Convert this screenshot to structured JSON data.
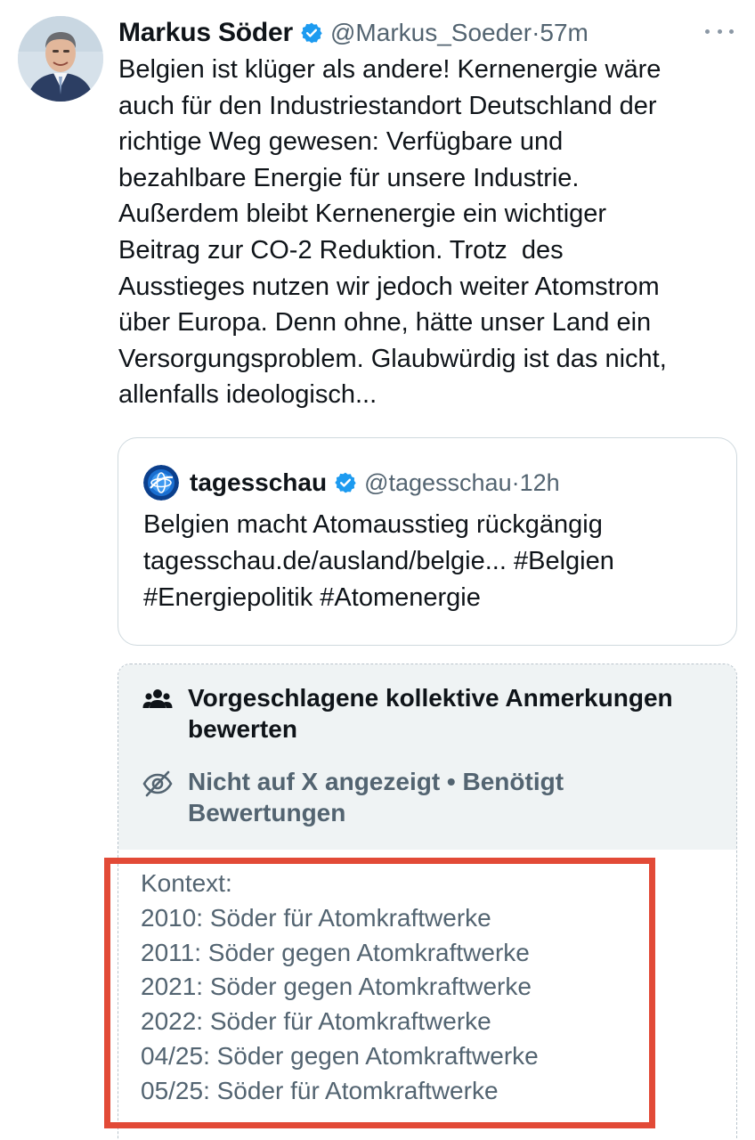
{
  "tweet": {
    "author_name": "Markus Söder",
    "handle": "@Markus_Soeder",
    "separator": " · ",
    "time": "57m",
    "lines": [
      "Belgien ist klüger als andere! Kernenergie wäre",
      "auch für den Industriestandort Deutschland der",
      "richtige Weg gewesen: Verfügbare und",
      "bezahlbare Energie für unsere Industrie.",
      "Außerdem bleibt Kernenergie ein wichtiger",
      "Beitrag zur CO-2 Reduktion. Trotz  des",
      "Ausstieges nutzen wir jedoch weiter Atomstrom",
      "über Europa. Denn ohne, hätte unser Land ein",
      "Versorgungsproblem. Glaubwürdig ist das nicht,",
      "allenfalls ideologisch..."
    ]
  },
  "quote": {
    "author_name": "tagesschau",
    "handle": "@tagesschau",
    "separator": " · ",
    "time": "12h",
    "lines": [
      "Belgien macht Atomausstieg rückgängig",
      "tagesschau.de/ausland/belgie... #Belgien",
      "#Energiepolitik #Atomenergie"
    ]
  },
  "community_note": {
    "title": "Vorgeschlagene kollektive Anmerkungen bewerten",
    "status": "Nicht auf X angezeigt • Benötigt Bewertungen",
    "context_lines": [
      "Kontext:",
      "2010: Söder für Atomkraftwerke",
      "2011: Söder gegen Atomkraftwerke",
      "2021: Söder gegen Atomkraftwerke",
      "2022: Söder für Atomkraftwerke",
      "04/25: Söder gegen Atomkraftwerke",
      "05/25: Söder für Atomkraftwerke"
    ]
  },
  "icons": {
    "verified": "verified-badge-icon",
    "more": "more-options-icon",
    "group": "people-group-icon",
    "hidden": "eye-slash-icon",
    "quote_logo": "tagesschau-globe-logo"
  },
  "colors": {
    "verified_blue": "#1d9bf0",
    "secondary_text": "#536471",
    "highlight_frame": "#e24a37",
    "note_background": "#eff3f4"
  }
}
